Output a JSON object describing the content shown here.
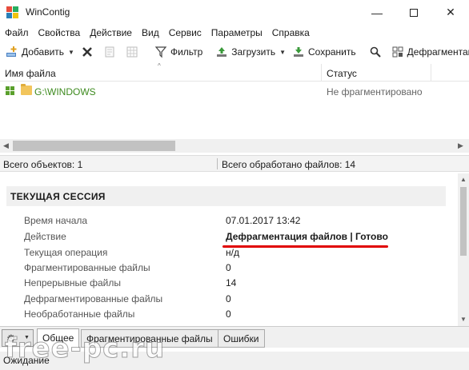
{
  "window": {
    "title": "WinContig",
    "minimize": "—",
    "close": "✕"
  },
  "menu": [
    "Файл",
    "Свойства",
    "Действие",
    "Вид",
    "Сервис",
    "Параметры",
    "Справка"
  ],
  "toolbar": {
    "add": "Добавить",
    "filter": "Фильтр",
    "load": "Загрузить",
    "save": "Сохранить",
    "defrag": "Дефрагментация"
  },
  "list": {
    "columns": {
      "name": "Имя файла",
      "status": "Статус"
    },
    "rows": [
      {
        "path": "G:\\WINDOWS",
        "status": "Не фрагментировано"
      }
    ]
  },
  "summary": {
    "objects": "Всего объектов:  1",
    "processed": "Всего обработано файлов:  14"
  },
  "session": {
    "title": "ТЕКУЩАЯ СЕССИЯ",
    "rows": [
      {
        "key": "Время начала",
        "value": "07.01.2017 13:42"
      },
      {
        "key": "Действие",
        "value": "Дефрагментация файлов | Готово"
      },
      {
        "key": "Текущая операция",
        "value": "н/д"
      },
      {
        "key": "Фрагментированные файлы",
        "value": "0"
      },
      {
        "key": "Непрерывные файлы",
        "value": "14"
      },
      {
        "key": "Дефрагментированные файлы",
        "value": "0"
      },
      {
        "key": "Необработанные файлы",
        "value": "0"
      }
    ]
  },
  "tabs": [
    "Общее",
    "Фрагментированные файлы",
    "Ошибки"
  ],
  "status": "Ожидание",
  "watermark": "free-pc.ru",
  "colors": {
    "accent_underline": "#e00000",
    "path_green": "#3d8a1e"
  }
}
